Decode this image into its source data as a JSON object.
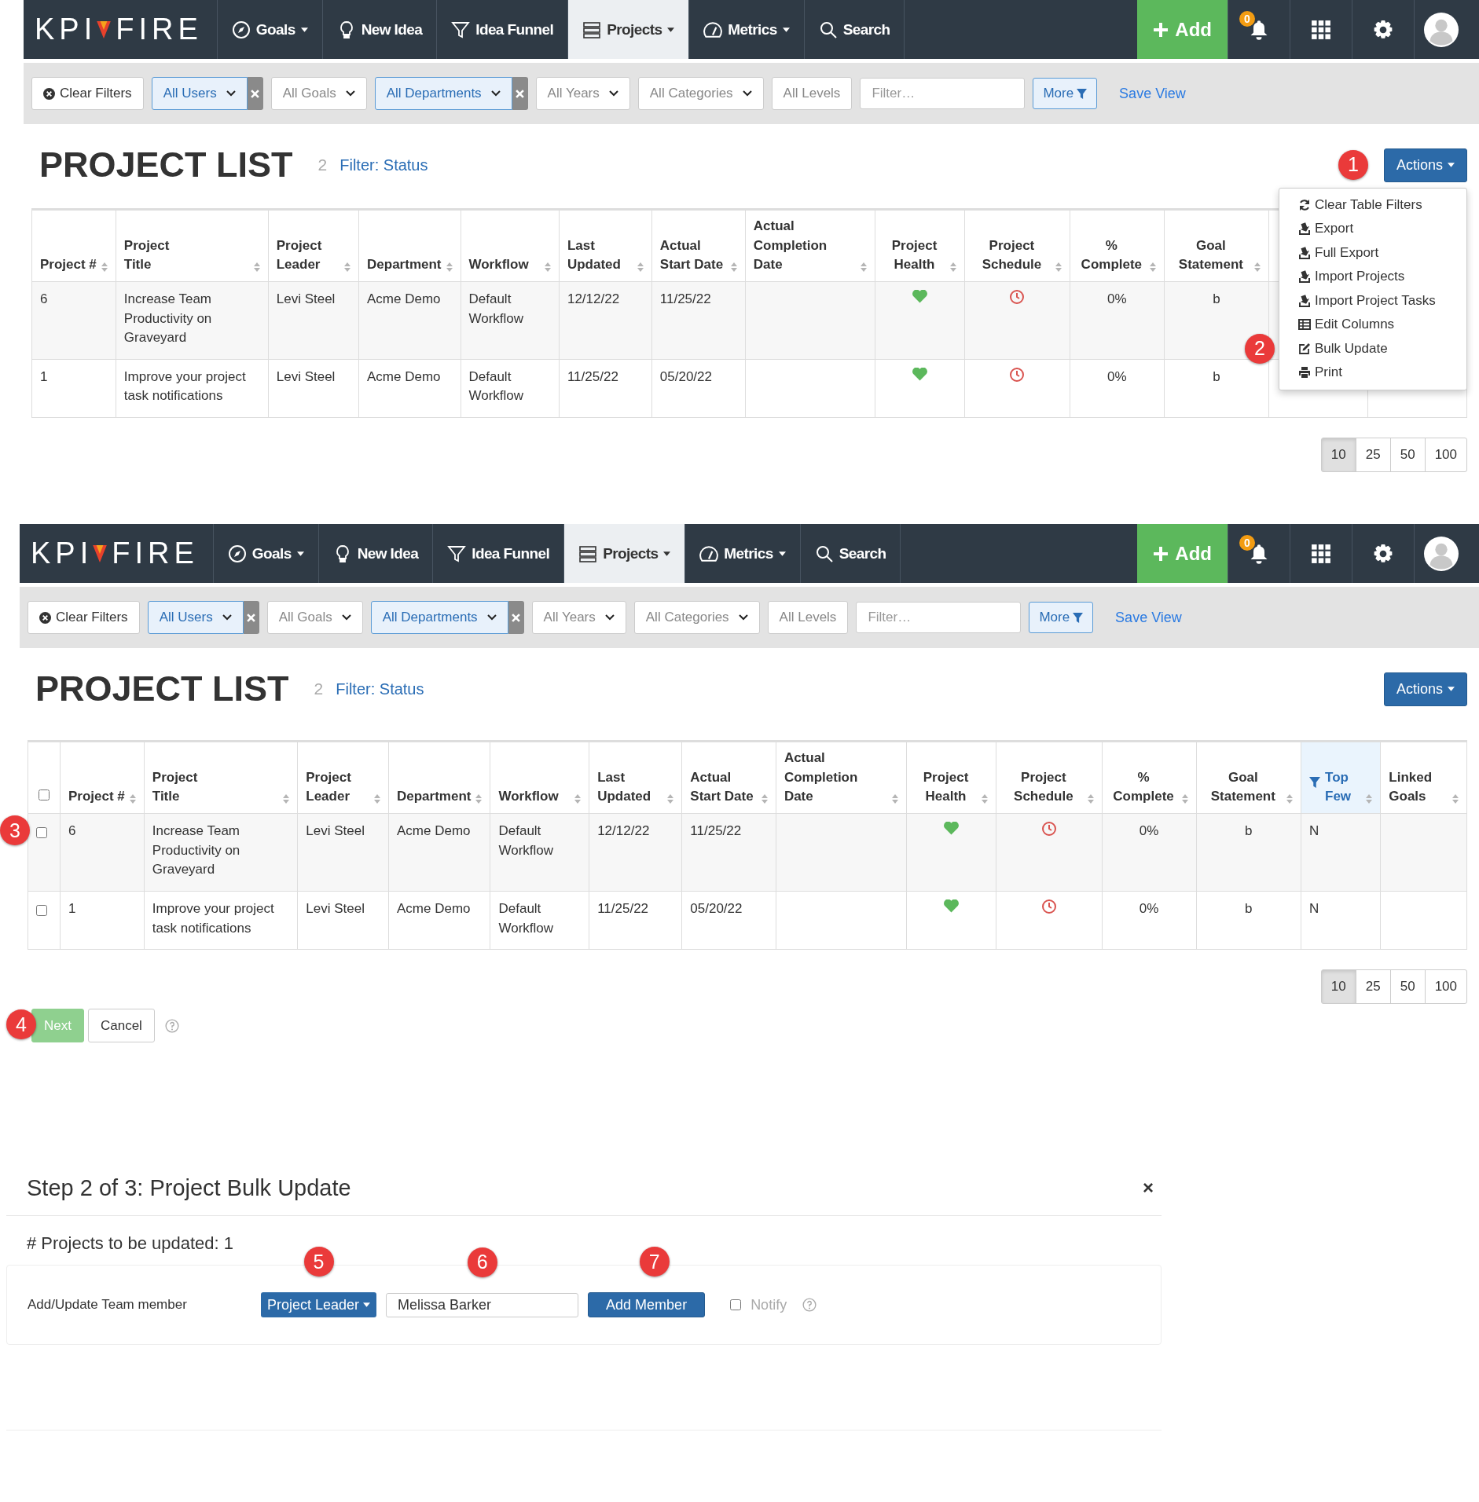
{
  "screens": [
    {
      "nav": {
        "logo": [
          "KPI",
          "FIRE"
        ],
        "items": [
          {
            "label": "Goals",
            "kind": "compass",
            "dropdown": true,
            "selected": false
          },
          {
            "label": "New Idea",
            "kind": "bulb",
            "dropdown": false,
            "selected": false
          },
          {
            "label": "Idea Funnel",
            "kind": "funnel",
            "dropdown": false,
            "selected": false
          },
          {
            "label": "Projects",
            "kind": "list",
            "dropdown": true,
            "selected": true
          },
          {
            "label": "Metrics",
            "kind": "gauge",
            "dropdown": true,
            "selected": false
          },
          {
            "label": "Search",
            "kind": "search",
            "dropdown": false,
            "selected": false
          }
        ],
        "add": "Add",
        "notifications": "0"
      },
      "filters": [
        {
          "kind": "button",
          "label": "Clear Filters"
        },
        {
          "kind": "select",
          "label": "All Users",
          "active": true
        },
        {
          "kind": "select",
          "label": "All Goals",
          "active": false
        },
        {
          "kind": "select",
          "label": "All Departments",
          "active": true
        },
        {
          "kind": "select",
          "label": "All Years",
          "active": false
        },
        {
          "kind": "select",
          "label": "All Categories",
          "active": false
        },
        {
          "kind": "plain",
          "label": "All Levels"
        },
        {
          "kind": "input",
          "placeholder": "Filter…"
        },
        {
          "kind": "more",
          "label": "More"
        },
        {
          "kind": "link",
          "label": "Save View"
        }
      ],
      "list": {
        "title": "PROJECT LIST",
        "count": "2",
        "filter_link": "Filter: Status",
        "actions": {
          "label": "Actions",
          "marker": "1"
        },
        "menu": [
          {
            "label": "Clear Table Filters",
            "kind": "refresh"
          },
          {
            "label": "Export",
            "kind": "export"
          },
          {
            "label": "Full Export",
            "kind": "export"
          },
          {
            "label": "Import Projects",
            "kind": "export"
          },
          {
            "label": "Import Project Tasks",
            "kind": "export"
          },
          {
            "label": "Edit Columns",
            "kind": "table"
          },
          {
            "label": "Bulk Update",
            "kind": "edit",
            "marker": "2"
          },
          {
            "label": "Print",
            "kind": "print"
          }
        ],
        "table": {
          "checkboxes": false,
          "columns": [
            {
              "label": "Project #",
              "kind": "text",
              "filtered": false
            },
            {
              "label": "Project Title",
              "kind": "text",
              "filtered": false
            },
            {
              "label": "Project Leader",
              "kind": "text",
              "filtered": false
            },
            {
              "label": "Department",
              "kind": "text",
              "filtered": false
            },
            {
              "label": "Workflow",
              "kind": "text",
              "filtered": false
            },
            {
              "label": "Last Updated",
              "kind": "text",
              "filtered": false
            },
            {
              "label": "Actual Start Date",
              "kind": "text",
              "filtered": false
            },
            {
              "label": "Actual Completion Date",
              "kind": "text",
              "filtered": false
            },
            {
              "label": "Project Health",
              "kind": "health",
              "filtered": false
            },
            {
              "label": "Project Schedule",
              "kind": "schedule",
              "filtered": false
            },
            {
              "label": "% Complete",
              "kind": "center",
              "filtered": false
            },
            {
              "label": "Goal Statement",
              "kind": "center",
              "filtered": false
            }
          ],
          "rows": [
            {
              "cells": [
                "6",
                "Increase Team Productivity on Graveyard",
                "Levi Steel",
                "Acme Demo",
                "Default Workflow",
                "12/12/22",
                "11/25/22",
                null,
                {
                  "color": "#5cb85c"
                },
                {
                  "color": "#d9534f"
                },
                "0%",
                "b"
              ]
            },
            {
              "cells": [
                "1",
                "Improve your project task notifications",
                "Levi Steel",
                "Acme Demo",
                "Default Workflow",
                "11/25/22",
                "05/20/22",
                null,
                {
                  "color": "#5cb85c"
                },
                {
                  "color": "#d9534f"
                },
                "0%",
                "b"
              ]
            }
          ]
        },
        "page_sizes": [
          {
            "label": "10",
            "selected": true
          },
          {
            "label": "25",
            "selected": false
          },
          {
            "label": "50",
            "selected": false
          },
          {
            "label": "100",
            "selected": false
          }
        ]
      }
    },
    {
      "nav": {
        "logo": [
          "KPI",
          "FIRE"
        ],
        "items": [
          {
            "label": "Goals",
            "kind": "compass",
            "dropdown": true,
            "selected": false
          },
          {
            "label": "New Idea",
            "kind": "bulb",
            "dropdown": false,
            "selected": false
          },
          {
            "label": "Idea Funnel",
            "kind": "funnel",
            "dropdown": false,
            "selected": false
          },
          {
            "label": "Projects",
            "kind": "list",
            "dropdown": true,
            "selected": true
          },
          {
            "label": "Metrics",
            "kind": "gauge",
            "dropdown": true,
            "selected": false
          },
          {
            "label": "Search",
            "kind": "search",
            "dropdown": false,
            "selected": false
          }
        ],
        "add": "Add",
        "notifications": "0"
      },
      "filters": [
        {
          "kind": "button",
          "label": "Clear Filters"
        },
        {
          "kind": "select",
          "label": "All Users",
          "active": true
        },
        {
          "kind": "select",
          "label": "All Goals",
          "active": false
        },
        {
          "kind": "select",
          "label": "All Departments",
          "active": true
        },
        {
          "kind": "select",
          "label": "All Years",
          "active": false
        },
        {
          "kind": "select",
          "label": "All Categories",
          "active": false
        },
        {
          "kind": "plain",
          "label": "All Levels"
        },
        {
          "kind": "input",
          "placeholder": "Filter…"
        },
        {
          "kind": "more",
          "label": "More"
        },
        {
          "kind": "link",
          "label": "Save View"
        }
      ],
      "list": {
        "title": "PROJECT LIST",
        "count": "2",
        "filter_link": "Filter: Status",
        "actions": {
          "label": "Actions"
        },
        "table": {
          "checkboxes": true,
          "all_checked": false,
          "columns": [
            {
              "label": "Project #",
              "kind": "text",
              "filtered": false
            },
            {
              "label": "Project Title",
              "kind": "text",
              "filtered": false
            },
            {
              "label": "Project Leader",
              "kind": "text",
              "filtered": false
            },
            {
              "label": "Department",
              "kind": "text",
              "filtered": false
            },
            {
              "label": "Workflow",
              "kind": "text",
              "filtered": false
            },
            {
              "label": "Last Updated",
              "kind": "text",
              "filtered": false
            },
            {
              "label": "Actual Start Date",
              "kind": "text",
              "filtered": false
            },
            {
              "label": "Actual Completion Date",
              "kind": "text",
              "filtered": false
            },
            {
              "label": "Project Health",
              "kind": "health",
              "filtered": false
            },
            {
              "label": "Project Schedule",
              "kind": "schedule",
              "filtered": false
            },
            {
              "label": "% Complete",
              "kind": "center",
              "filtered": false
            },
            {
              "label": "Goal Statement",
              "kind": "center",
              "filtered": false
            },
            {
              "label": "Top Few",
              "kind": "text",
              "filtered": true
            },
            {
              "label": "Linked Goals",
              "kind": "text",
              "filtered": false
            }
          ],
          "rows": [
            {
              "checked": false,
              "marker": "3",
              "cells": [
                "6",
                "Increase Team Productivity on Graveyard",
                "Levi Steel",
                "Acme Demo",
                "Default Workflow",
                "12/12/22",
                "11/25/22",
                null,
                {
                  "color": "#5cb85c"
                },
                {
                  "color": "#d9534f"
                },
                "0%",
                "b",
                "N",
                null
              ]
            },
            {
              "checked": false,
              "cells": [
                "1",
                "Improve your project task notifications",
                "Levi Steel",
                "Acme Demo",
                "Default Workflow",
                "11/25/22",
                "05/20/22",
                null,
                {
                  "color": "#5cb85c"
                },
                {
                  "color": "#d9534f"
                },
                "0%",
                "b",
                "N",
                null
              ]
            }
          ]
        },
        "page_sizes": [
          {
            "label": "10",
            "selected": true
          },
          {
            "label": "25",
            "selected": false
          },
          {
            "label": "50",
            "selected": false
          },
          {
            "label": "100",
            "selected": false
          }
        ]
      },
      "footer": [
        {
          "label": "Next",
          "kind": "success",
          "marker": "4"
        },
        {
          "label": "Cancel",
          "kind": "default"
        }
      ]
    }
  ],
  "modal": {
    "title": "Step 2 of 3: Project Bulk Update",
    "close": "×",
    "count_text": "# Projects to be updated: 1",
    "row": {
      "label": "Add/Update Team member",
      "role": {
        "label": "Project Leader",
        "marker": "5"
      },
      "member": {
        "value": "Melissa Barker",
        "marker": "6"
      },
      "add": {
        "label": "Add Member",
        "marker": "7"
      },
      "notify": {
        "label": "Notify",
        "checked": false
      }
    }
  }
}
